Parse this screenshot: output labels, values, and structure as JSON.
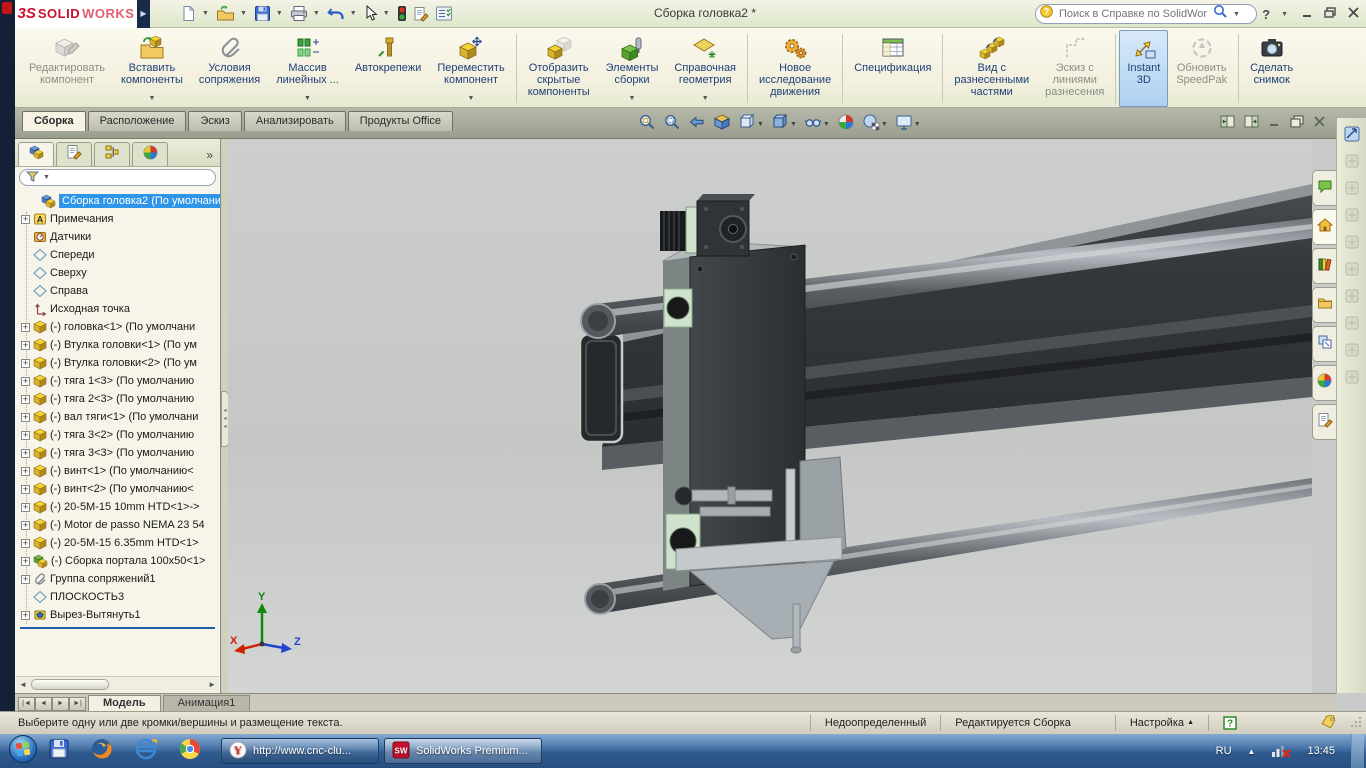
{
  "titlebar": {
    "mark": "3S",
    "solid": "SOLID",
    "works": "WORKS",
    "title": "Сборка головка2 *",
    "search_placeholder": "Поиск в Справке по SolidWorks",
    "tools": [
      {
        "id": "new",
        "dropdown": true
      },
      {
        "id": "open",
        "dropdown": true
      },
      {
        "id": "save",
        "dropdown": true
      },
      {
        "id": "print",
        "dropdown": true
      },
      {
        "id": "undo",
        "dropdown": true
      },
      {
        "id": "select",
        "dropdown": true
      },
      {
        "id": "display-colors",
        "dropdown": false
      },
      {
        "id": "properties",
        "dropdown": false
      },
      {
        "id": "options",
        "dropdown": false
      }
    ]
  },
  "ribbon": {
    "buttons": [
      {
        "id": "edit-component",
        "lines": [
          "Редактировать",
          "компонент"
        ],
        "dropdown": false,
        "disabled": true,
        "active": false,
        "sep_after": false
      },
      {
        "id": "insert-components",
        "lines": [
          "Вставить",
          "компоненты"
        ],
        "dropdown": true,
        "disabled": false,
        "active": false,
        "sep_after": false
      },
      {
        "id": "mate",
        "lines": [
          "Условия",
          "сопряжения"
        ],
        "dropdown": false,
        "disabled": false,
        "active": false,
        "sep_after": false
      },
      {
        "id": "linear-pattern",
        "lines": [
          "Массив",
          "линейных ..."
        ],
        "dropdown": true,
        "disabled": false,
        "active": false,
        "sep_after": false
      },
      {
        "id": "smart-fasteners",
        "lines": [
          "Автокрепежи"
        ],
        "dropdown": false,
        "disabled": false,
        "active": false,
        "sep_after": false
      },
      {
        "id": "move-component",
        "lines": [
          "Переместить",
          "компонент"
        ],
        "dropdown": true,
        "disabled": false,
        "active": false,
        "sep_after": true
      },
      {
        "id": "show-hidden",
        "lines": [
          "Отобразить",
          "скрытые",
          "компоненты"
        ],
        "dropdown": false,
        "disabled": false,
        "active": false,
        "sep_after": false
      },
      {
        "id": "assembly-features",
        "lines": [
          "Элементы",
          "сборки"
        ],
        "dropdown": true,
        "disabled": false,
        "active": false,
        "sep_after": false
      },
      {
        "id": "reference-geometry",
        "lines": [
          "Справочная",
          "геометрия"
        ],
        "dropdown": true,
        "disabled": false,
        "active": false,
        "sep_after": true
      },
      {
        "id": "motion-study",
        "lines": [
          "Новое",
          "исследование",
          "движения"
        ],
        "dropdown": false,
        "disabled": false,
        "active": false,
        "sep_after": true
      },
      {
        "id": "bom",
        "lines": [
          "Спецификация"
        ],
        "dropdown": false,
        "disabled": false,
        "active": false,
        "sep_after": true
      },
      {
        "id": "exploded-view",
        "lines": [
          "Вид с",
          "разнесенными",
          "частями"
        ],
        "dropdown": false,
        "disabled": false,
        "active": false,
        "sep_after": false
      },
      {
        "id": "explode-lines",
        "lines": [
          "Эскиз с",
          "линиями",
          "разнесения"
        ],
        "dropdown": false,
        "disabled": true,
        "active": false,
        "sep_after": true
      },
      {
        "id": "instant3d",
        "lines": [
          "Instant",
          "3D"
        ],
        "dropdown": false,
        "disabled": false,
        "active": true,
        "sep_after": false
      },
      {
        "id": "speedpak",
        "lines": [
          "Обновить",
          "SpeedPak"
        ],
        "dropdown": false,
        "disabled": true,
        "active": false,
        "sep_after": true
      },
      {
        "id": "snapshot",
        "lines": [
          "Сделать",
          "снимок"
        ],
        "dropdown": false,
        "disabled": false,
        "active": false,
        "sep_after": false
      }
    ]
  },
  "command_tabs": [
    {
      "label": "Сборка",
      "active": true
    },
    {
      "label": "Расположение",
      "active": false
    },
    {
      "label": "Эскиз",
      "active": false
    },
    {
      "label": "Анализировать",
      "active": false
    },
    {
      "label": "Продукты Office",
      "active": false
    }
  ],
  "headsup": [
    {
      "id": "zoom-to-fit",
      "dropdown": false
    },
    {
      "id": "zoom-to-area",
      "dropdown": false
    },
    {
      "id": "previous-view",
      "dropdown": false
    },
    {
      "id": "section-view",
      "dropdown": false
    },
    {
      "id": "view-orientation",
      "dropdown": true
    },
    {
      "id": "display-style",
      "dropdown": true
    },
    {
      "id": "hide-show-items",
      "dropdown": true
    },
    {
      "id": "edit-appearance",
      "dropdown": false
    },
    {
      "id": "apply-scene",
      "dropdown": true
    },
    {
      "id": "view-settings",
      "dropdown": true
    }
  ],
  "feature_panel": {
    "tabs": [
      "features",
      "property-manager",
      "configurations",
      "display-manager"
    ],
    "more": "»",
    "tree": [
      {
        "icon": "assembly-root",
        "label": "Сборка головка2 (По умолчани",
        "root": true,
        "selected": true,
        "expand": false
      },
      {
        "icon": "annotations",
        "label": "Примечания",
        "expand": true
      },
      {
        "icon": "sensors",
        "label": "Датчики",
        "expand": false
      },
      {
        "icon": "plane",
        "label": "Спереди",
        "expand": false
      },
      {
        "icon": "plane",
        "label": "Сверху",
        "expand": false
      },
      {
        "icon": "plane",
        "label": "Справа",
        "expand": false
      },
      {
        "icon": "origin",
        "label": "Исходная точка",
        "expand": false
      },
      {
        "icon": "part",
        "label": "(-) головка<1> (По умолчани",
        "expand": true
      },
      {
        "icon": "part",
        "label": "(-) Втулка головки<1> (По ум",
        "expand": true
      },
      {
        "icon": "part",
        "label": "(-) Втулка головки<2> (По ум",
        "expand": true
      },
      {
        "icon": "part",
        "label": "(-) тяга 1<3> (По умолчанию",
        "expand": true
      },
      {
        "icon": "part",
        "label": "(-) тяга 2<3> (По умолчанию",
        "expand": true
      },
      {
        "icon": "part",
        "label": "(-) вал тяги<1> (По умолчани",
        "expand": true
      },
      {
        "icon": "part",
        "label": "(-) тяга 3<2> (По умолчанию",
        "expand": true
      },
      {
        "icon": "part",
        "label": "(-) тяга 3<3> (По умолчанию",
        "expand": true
      },
      {
        "icon": "part",
        "label": "(-) винт<1> (По умолчанию<",
        "expand": true
      },
      {
        "icon": "part",
        "label": "(-) винт<2> (По умолчанию<",
        "expand": true
      },
      {
        "icon": "part",
        "label": "(-) 20-5M-15 10mm HTD<1>->",
        "expand": true
      },
      {
        "icon": "part",
        "label": "(-) Motor de passo NEMA 23 54",
        "expand": true
      },
      {
        "icon": "part",
        "label": "(-) 20-5M-15 6.35mm HTD<1>",
        "expand": true
      },
      {
        "icon": "assembly",
        "label": "(-) Сборка портала 100x50<1>",
        "expand": true
      },
      {
        "icon": "mategroup",
        "label": "Группа сопряжений1",
        "expand": true
      },
      {
        "icon": "plane",
        "label": "ПЛОСКОСТЬ3",
        "expand": false
      },
      {
        "icon": "cutextrude",
        "label": "Вырез-Вытянуть1",
        "expand": true
      }
    ]
  },
  "taskpane": [
    "forum",
    "solidworks-resources",
    "design-library",
    "file-explorer",
    "view-palette",
    "appearances",
    "custom-properties"
  ],
  "right_toolbar": [
    "instant-tool",
    "tool-1",
    "tool-2",
    "tool-3",
    "tool-4",
    "tool-5",
    "tool-6",
    "tool-7",
    "tool-8",
    "tool-9"
  ],
  "model_tabs": {
    "nav": [
      "|◄",
      "◄",
      "►",
      "►|"
    ],
    "tabs": [
      {
        "label": "Модель",
        "active": true
      },
      {
        "label": "Анимация1",
        "active": false
      }
    ]
  },
  "statusbar": {
    "message": "Выберите одну или две кромки/вершины и размещение текста.",
    "state": "Недоопределенный",
    "mode": "Редактируется Сборка",
    "custom": "Настройка"
  },
  "taskbar": {
    "tasks": [
      {
        "label": "http://www.cnc-clu...",
        "icon": "yandex",
        "active": false
      },
      {
        "label": "SolidWorks Premium...",
        "icon": "solidworks",
        "active": true
      }
    ],
    "lang": "RU",
    "time": "13:45"
  },
  "triad": {
    "x": "X",
    "y": "Y",
    "z": "Z"
  }
}
